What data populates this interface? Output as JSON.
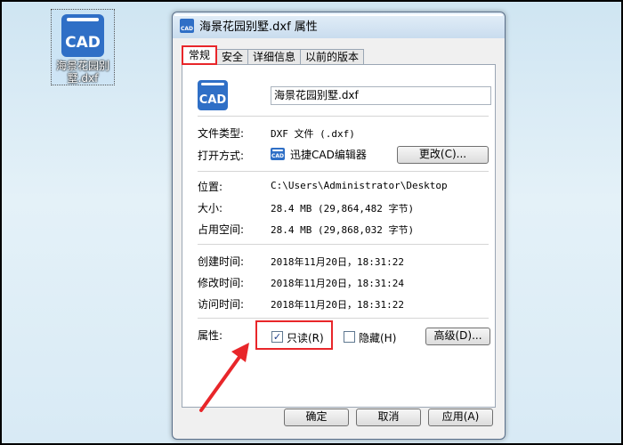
{
  "desktop": {
    "icon_logo_text": "CAD",
    "icon_label": "海景花园别墅.dxf"
  },
  "dialog": {
    "title": "海景花园别墅.dxf 属性",
    "tabs": [
      {
        "label": "常规",
        "active": true
      },
      {
        "label": "安全",
        "active": false
      },
      {
        "label": "详细信息",
        "active": false
      },
      {
        "label": "以前的版本",
        "active": false
      }
    ],
    "general": {
      "file_name": "海景花园别墅.dxf",
      "file_type_label": "文件类型:",
      "file_type_value": "DXF 文件 (.dxf)",
      "open_with_label": "打开方式:",
      "open_with_value": "迅捷CAD编辑器",
      "change_button": "更改(C)...",
      "location_label": "位置:",
      "location_value": "C:\\Users\\Administrator\\Desktop",
      "size_label": "大小:",
      "size_value": "28.4 MB (29,864,482 字节)",
      "disk_size_label": "占用空间:",
      "disk_size_value": "28.4 MB (29,868,032 字节)",
      "created_label": "创建时间:",
      "created_value": "2018年11月20日，18:31:22",
      "modified_label": "修改时间:",
      "modified_value": "2018年11月20日，18:31:24",
      "accessed_label": "访问时间:",
      "accessed_value": "2018年11月20日，18:31:22",
      "attributes_label": "属性:",
      "readonly_label": "只读(R)",
      "readonly_checked": true,
      "hidden_label": "隐藏(H)",
      "hidden_checked": false,
      "advanced_button": "高级(D)..."
    },
    "buttons": {
      "ok": "确定",
      "cancel": "取消",
      "apply": "应用(A)"
    }
  },
  "colors": {
    "highlight": "#e8262a",
    "cad_logo": "#2f6fc6"
  },
  "icons": [
    "cad-file-icon",
    "checkmark-icon",
    "red-arrow-annotation"
  ]
}
